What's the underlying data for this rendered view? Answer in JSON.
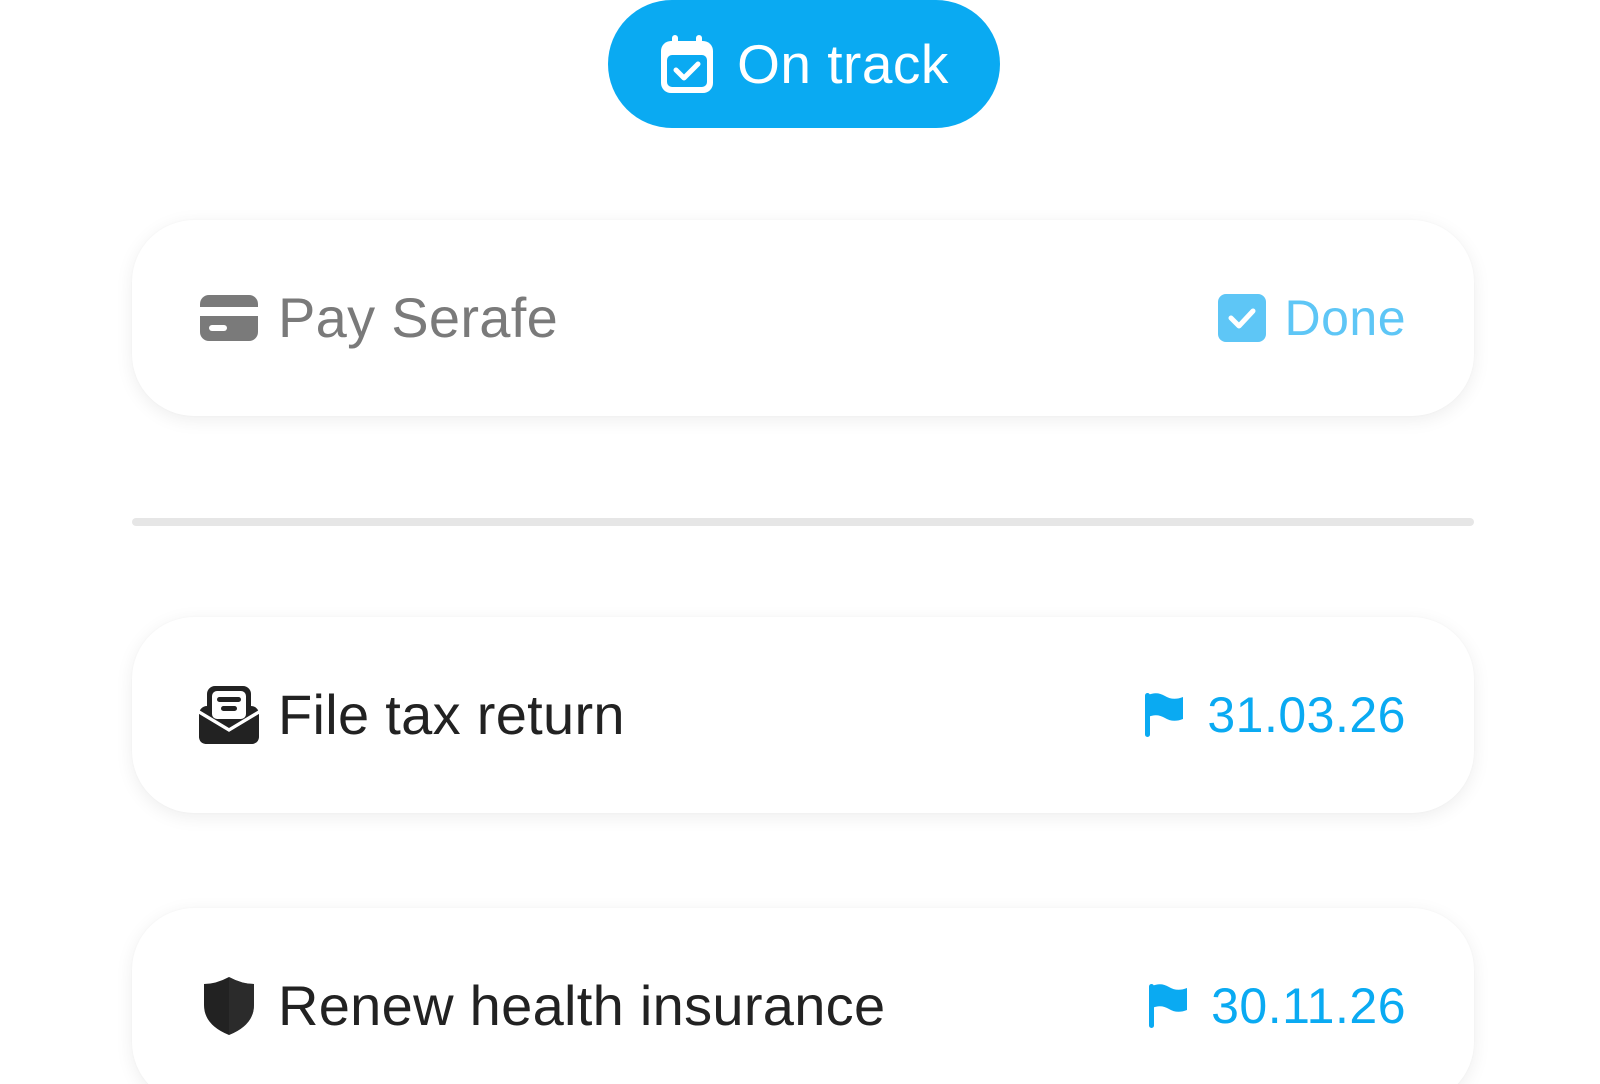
{
  "status": {
    "label": "On track",
    "icon": "calendar-check-icon",
    "color": "#0aaaf2"
  },
  "done_tasks": [
    {
      "title": "Pay Serafe",
      "icon": "credit-card-icon",
      "status_label": "Done",
      "status_icon": "checkbox-checked-icon"
    }
  ],
  "open_tasks": [
    {
      "title": "File tax return",
      "icon": "tray-icon",
      "due": "31.03.26",
      "due_icon": "flag-icon"
    },
    {
      "title": "Renew health insurance",
      "icon": "shield-icon",
      "due": "30.11.26",
      "due_icon": "flag-icon"
    }
  ],
  "colors": {
    "accent": "#0aaaf2",
    "done_accent": "#5ec6f6",
    "text": "#222222",
    "done_text": "#7a7a7a",
    "divider": "#e6e6e6"
  }
}
